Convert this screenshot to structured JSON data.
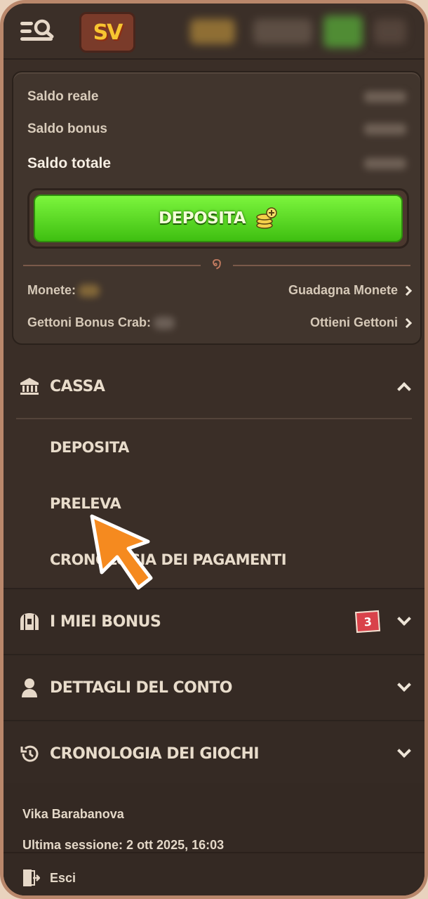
{
  "header": {
    "logo_text": "SV",
    "icons": [
      "menu-search-icon",
      "coin-icon",
      "gift-icon",
      "user-icon"
    ]
  },
  "balance": {
    "real_label": "Saldo reale",
    "bonus_label": "Saldo bonus",
    "total_label": "Saldo totale",
    "deposit_label": "DEPOSITA",
    "coins_label": "Monete:",
    "earn_coins_label": "Guadagna Monete",
    "crab_tokens_label": "Gettoni Bonus Crab:",
    "get_tokens_label": "Ottieni Gettoni"
  },
  "menu": {
    "cassa": {
      "label": "CASSA",
      "items": [
        "DEPOSITA",
        "PRELEVA",
        "CRONOLOGIA DEI PAGAMENTI"
      ]
    },
    "bonus": {
      "label": "I MIEI BONUS",
      "badge": "3"
    },
    "account": {
      "label": "DETTAGLI DEL CONTO"
    },
    "history": {
      "label": "CRONOLOGIA DEI GIOCHI"
    }
  },
  "footer": {
    "user_name": "Vika Barabanova",
    "last_session": "Ultima sessione: 2 ott 2025, 16:03",
    "logout_label": "Esci"
  },
  "colors": {
    "background": "#3a2e27",
    "deposit_green": "#4fd61a",
    "badge_red": "#d9424a",
    "pointer_orange": "#f58a1f"
  }
}
